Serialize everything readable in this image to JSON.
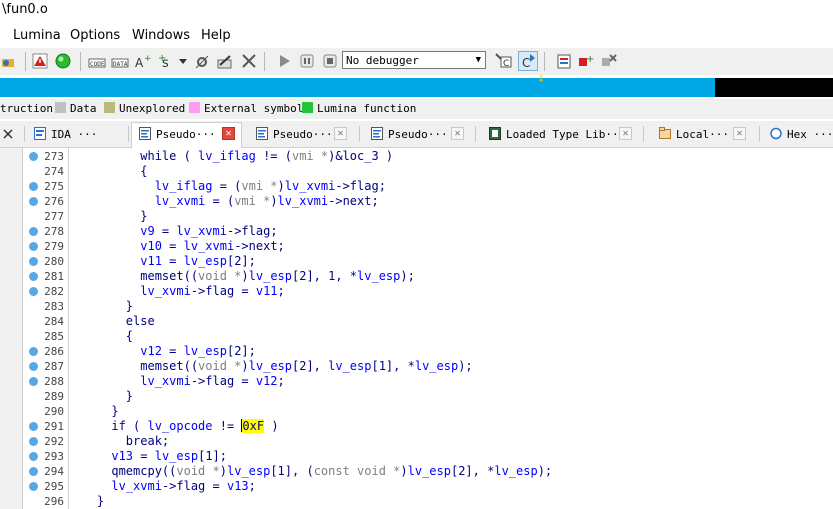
{
  "window": {
    "title": "\\fun0.o"
  },
  "menu": [
    "Lumina",
    "Options",
    "Windows",
    "Help"
  ],
  "toolbar": {
    "debugger_select": "No debugger"
  },
  "legend": [
    {
      "label": "truction",
      "color": ""
    },
    {
      "label": "Data",
      "color": "#c0c0c0"
    },
    {
      "label": "Unexplored",
      "color": "#b9b97d"
    },
    {
      "label": "External symbol",
      "color": "#ff9cf0"
    },
    {
      "label": "Lumina function",
      "color": "#22c43a"
    }
  ],
  "tabs": [
    {
      "label": "IDA ···",
      "icon": "ida-view-icon"
    },
    {
      "label": "Pseudo···",
      "icon": "pseudocode-icon",
      "active": true
    },
    {
      "label": "Pseudo···",
      "icon": "pseudocode-icon"
    },
    {
      "label": "Pseudo···",
      "icon": "pseudocode-icon"
    },
    {
      "label": "Loaded Type Lib···",
      "icon": "type-library-icon"
    },
    {
      "label": "Local···",
      "icon": "local-types-icon"
    },
    {
      "label": "Hex ···",
      "icon": "hex-view-icon"
    }
  ],
  "colors": {
    "nav_blue": "#00a8e6",
    "breakpoint_dot": "#56a8e6",
    "highlight": "#ffff00",
    "code_text": "#000080",
    "variable": "#0000ff"
  },
  "code_lines": [
    {
      "num": "273",
      "dot": true,
      "tokens": [
        [
          "p",
          "          while ( "
        ],
        [
          "v",
          "lv_iflag"
        ],
        [
          "p",
          " != ("
        ],
        [
          "g",
          "vmi *"
        ],
        [
          "p",
          ")&loc_3 )"
        ]
      ]
    },
    {
      "num": "274",
      "dot": false,
      "tokens": [
        [
          "p",
          "          {"
        ]
      ]
    },
    {
      "num": "275",
      "dot": true,
      "tokens": [
        [
          "p",
          "            "
        ],
        [
          "v",
          "lv_iflag"
        ],
        [
          "p",
          " = ("
        ],
        [
          "g",
          "vmi *"
        ],
        [
          "p",
          ")"
        ],
        [
          "v",
          "lv_xvmi"
        ],
        [
          "p",
          "->flag;"
        ]
      ]
    },
    {
      "num": "276",
      "dot": true,
      "tokens": [
        [
          "p",
          "            "
        ],
        [
          "v",
          "lv_xvmi"
        ],
        [
          "p",
          " = ("
        ],
        [
          "g",
          "vmi *"
        ],
        [
          "p",
          ")"
        ],
        [
          "v",
          "lv_xvmi"
        ],
        [
          "p",
          "->next;"
        ]
      ]
    },
    {
      "num": "277",
      "dot": false,
      "tokens": [
        [
          "p",
          "          }"
        ]
      ]
    },
    {
      "num": "278",
      "dot": true,
      "tokens": [
        [
          "p",
          "          "
        ],
        [
          "v",
          "v9"
        ],
        [
          "p",
          " = "
        ],
        [
          "v",
          "lv_xvmi"
        ],
        [
          "p",
          "->flag;"
        ]
      ]
    },
    {
      "num": "279",
      "dot": true,
      "tokens": [
        [
          "p",
          "          "
        ],
        [
          "v",
          "v10"
        ],
        [
          "p",
          " = "
        ],
        [
          "v",
          "lv_xvmi"
        ],
        [
          "p",
          "->next;"
        ]
      ]
    },
    {
      "num": "280",
      "dot": true,
      "tokens": [
        [
          "p",
          "          "
        ],
        [
          "v",
          "v11"
        ],
        [
          "p",
          " = "
        ],
        [
          "v",
          "lv_esp"
        ],
        [
          "p",
          "[2];"
        ]
      ]
    },
    {
      "num": "281",
      "dot": true,
      "tokens": [
        [
          "p",
          "          memset(("
        ],
        [
          "g",
          "void *"
        ],
        [
          "p",
          ")"
        ],
        [
          "v",
          "lv_esp"
        ],
        [
          "p",
          "[2], 1, *"
        ],
        [
          "v",
          "lv_esp"
        ],
        [
          "p",
          ");"
        ]
      ]
    },
    {
      "num": "282",
      "dot": true,
      "tokens": [
        [
          "p",
          "          "
        ],
        [
          "v",
          "lv_xvmi"
        ],
        [
          "p",
          "->flag = "
        ],
        [
          "v",
          "v11"
        ],
        [
          "p",
          ";"
        ]
      ]
    },
    {
      "num": "283",
      "dot": false,
      "tokens": [
        [
          "p",
          "        }"
        ]
      ]
    },
    {
      "num": "284",
      "dot": false,
      "tokens": [
        [
          "p",
          "        else"
        ]
      ]
    },
    {
      "num": "285",
      "dot": false,
      "tokens": [
        [
          "p",
          "        {"
        ]
      ]
    },
    {
      "num": "286",
      "dot": true,
      "tokens": [
        [
          "p",
          "          "
        ],
        [
          "v",
          "v12"
        ],
        [
          "p",
          " = "
        ],
        [
          "v",
          "lv_esp"
        ],
        [
          "p",
          "[2];"
        ]
      ]
    },
    {
      "num": "287",
      "dot": true,
      "tokens": [
        [
          "p",
          "          memset(("
        ],
        [
          "g",
          "void *"
        ],
        [
          "p",
          ")"
        ],
        [
          "v",
          "lv_esp"
        ],
        [
          "p",
          "[2], "
        ],
        [
          "v",
          "lv_esp"
        ],
        [
          "p",
          "[1], *"
        ],
        [
          "v",
          "lv_esp"
        ],
        [
          "p",
          ");"
        ]
      ]
    },
    {
      "num": "288",
      "dot": true,
      "tokens": [
        [
          "p",
          "          "
        ],
        [
          "v",
          "lv_xvmi"
        ],
        [
          "p",
          "->flag = "
        ],
        [
          "v",
          "v12"
        ],
        [
          "p",
          ";"
        ]
      ]
    },
    {
      "num": "289",
      "dot": false,
      "tokens": [
        [
          "p",
          "        }"
        ]
      ]
    },
    {
      "num": "290",
      "dot": false,
      "tokens": [
        [
          "p",
          "      }"
        ]
      ]
    },
    {
      "num": "291",
      "dot": true,
      "tokens": [
        [
          "p",
          "      if ( "
        ],
        [
          "v",
          "lv_opcode"
        ],
        [
          "p",
          " != "
        ],
        [
          "cur",
          ""
        ],
        [
          "hl",
          "0xF"
        ],
        [
          "p",
          " )"
        ]
      ]
    },
    {
      "num": "292",
      "dot": true,
      "tokens": [
        [
          "p",
          "        break;"
        ]
      ]
    },
    {
      "num": "293",
      "dot": true,
      "tokens": [
        [
          "p",
          "      "
        ],
        [
          "v",
          "v13"
        ],
        [
          "p",
          " = "
        ],
        [
          "v",
          "lv_esp"
        ],
        [
          "p",
          "[1];"
        ]
      ]
    },
    {
      "num": "294",
      "dot": true,
      "tokens": [
        [
          "p",
          "      qmemcpy(("
        ],
        [
          "g",
          "void *"
        ],
        [
          "p",
          ")"
        ],
        [
          "v",
          "lv_esp"
        ],
        [
          "p",
          "[1], ("
        ],
        [
          "g",
          "const void *"
        ],
        [
          "p",
          ")"
        ],
        [
          "v",
          "lv_esp"
        ],
        [
          "p",
          "[2], *"
        ],
        [
          "v",
          "lv_esp"
        ],
        [
          "p",
          ");"
        ]
      ]
    },
    {
      "num": "295",
      "dot": true,
      "tokens": [
        [
          "p",
          "      "
        ],
        [
          "v",
          "lv_xvmi"
        ],
        [
          "p",
          "->flag = "
        ],
        [
          "v",
          "v13"
        ],
        [
          "p",
          ";"
        ]
      ]
    },
    {
      "num": "296",
      "dot": false,
      "tokens": [
        [
          "p",
          "    }"
        ]
      ]
    }
  ]
}
